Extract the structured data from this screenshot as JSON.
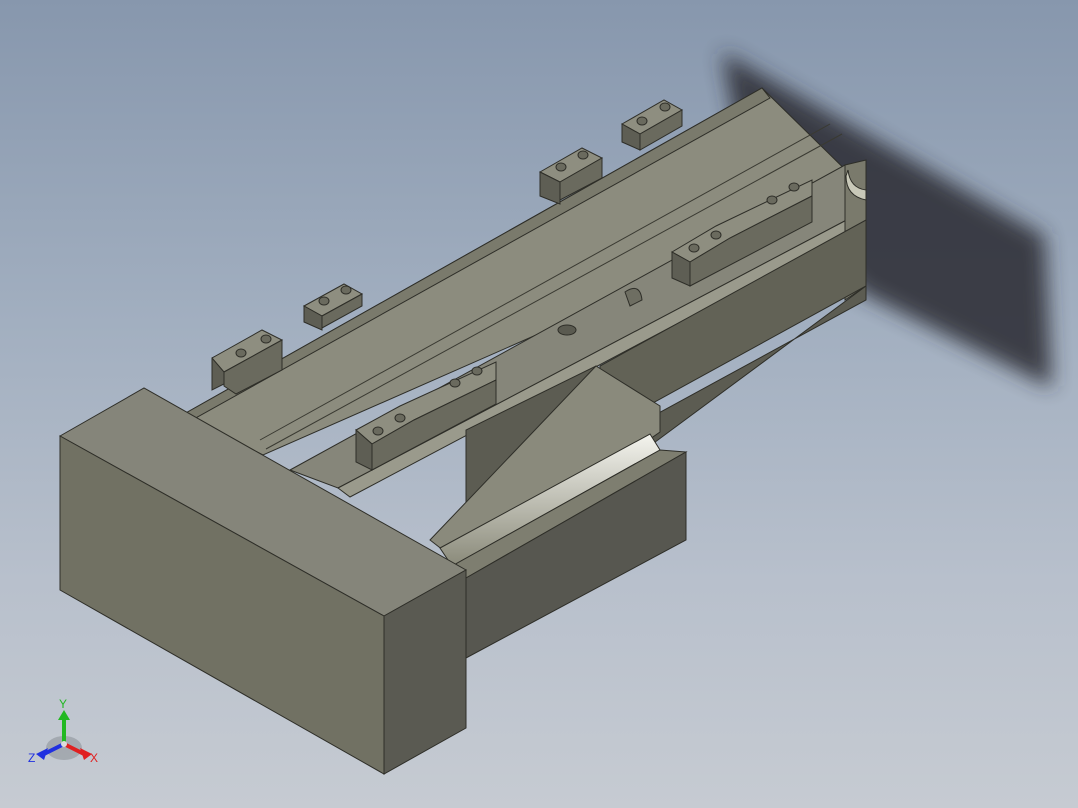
{
  "viewport": {
    "background_top": "#8797ad",
    "background_bottom": "#c6cbd2",
    "part_color": "#7a7a6a",
    "shadow_color": "#2a2c30"
  },
  "triad": {
    "y_label": "Y",
    "x_label": "X",
    "z_label": "Z",
    "y_color": "#22b822",
    "x_color": "#e02020",
    "z_color": "#2030e0"
  }
}
